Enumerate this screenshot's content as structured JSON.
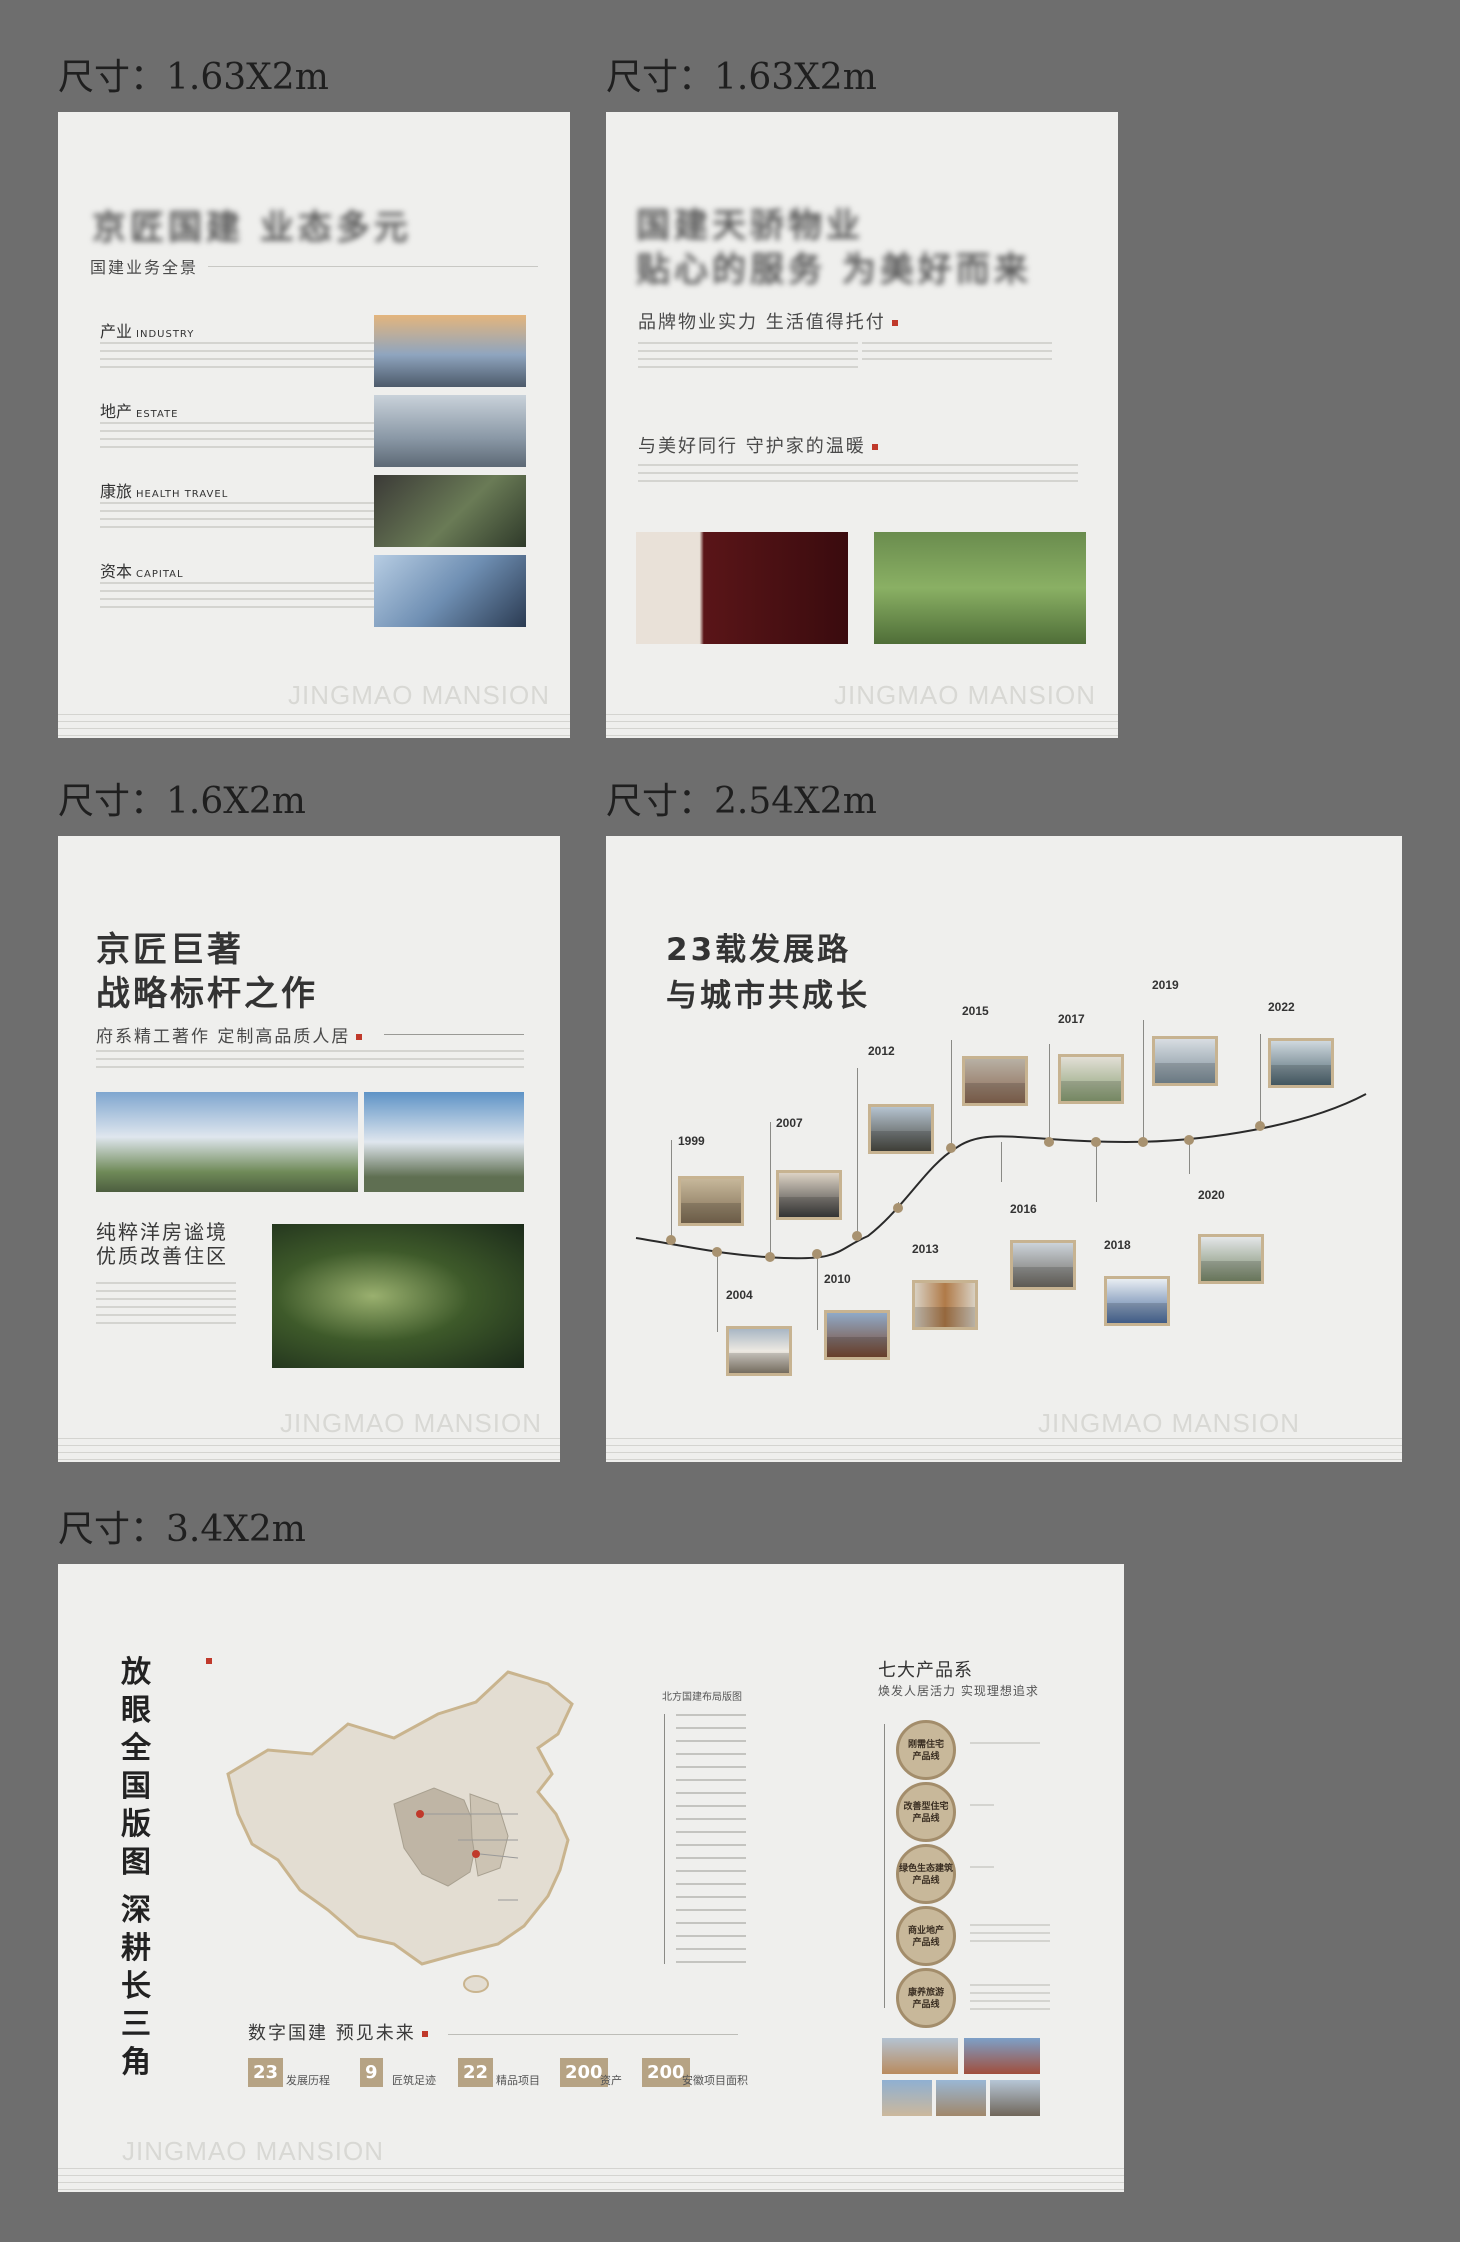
{
  "size_labels": {
    "p1": "尺寸：1.63X2m",
    "p2": "尺寸：1.63X2m",
    "p3": "尺寸：1.6X2m",
    "p4": "尺寸：2.54X2m",
    "p5": "尺寸：3.4X2m"
  },
  "watermark": "JINGMAO MANSION",
  "panel1": {
    "title": "京匠国建 业态多元",
    "subtitle": "国建业务全景",
    "sections": [
      {
        "cn": "产业",
        "en": "INDUSTRY"
      },
      {
        "cn": "地产",
        "en": "ESTATE"
      },
      {
        "cn": "康旅",
        "en": "HEALTH TRAVEL"
      },
      {
        "cn": "资本",
        "en": "CAPITAL"
      }
    ]
  },
  "panel2": {
    "title_line1": "国建天骄物业",
    "title_line2": "贴心的服务 为美好而来",
    "heading1": "品牌物业实力 生活值得托付",
    "heading2": "与美好同行  守护家的温暖"
  },
  "panel3": {
    "title_line1": "京匠巨著",
    "title_line2": "战略标杆之作",
    "heading1": "府系精工著作  定制高品质人居",
    "heading2_line1": "纯粹洋房谧境",
    "heading2_line2": "优质改善住区"
  },
  "panel4": {
    "title_line1": "23载发展路",
    "title_line2": "与城市共成长",
    "years": [
      "1999",
      "2004",
      "2007",
      "2010",
      "2012",
      "2013",
      "2015",
      "2016",
      "2017",
      "2018",
      "2019",
      "2020",
      "2022"
    ]
  },
  "panel5": {
    "vertical_title1": "放眼全国版图",
    "vertical_title2": "深耕长三角",
    "list_title": "北方国建布局版图",
    "stats_title": "数字国建  预见未来",
    "stats": [
      {
        "value": "23",
        "label": "发展历程"
      },
      {
        "value": "9",
        "label": "匠筑足迹"
      },
      {
        "value": "22",
        "label": "精品项目"
      },
      {
        "value": "200",
        "label": "资产"
      },
      {
        "value": "200",
        "label": "安徽项目面积"
      }
    ],
    "products_title": "七大产品系",
    "products_sub": "焕发人居活力 实现理想追求",
    "products": [
      {
        "name": "刚需住宅",
        "line": "产品线"
      },
      {
        "name": "改善型住宅",
        "line": "产品线"
      },
      {
        "name": "绿色生态建筑",
        "line": "产品线"
      },
      {
        "name": "商业地产",
        "line": "产品线"
      },
      {
        "name": "康养旅游",
        "line": "产品线"
      }
    ]
  },
  "colors": {
    "accent_gold": "#b6a384",
    "accent_red": "#c0392b",
    "panel_bg": "#efefed",
    "page_bg": "#6e6e6e"
  }
}
